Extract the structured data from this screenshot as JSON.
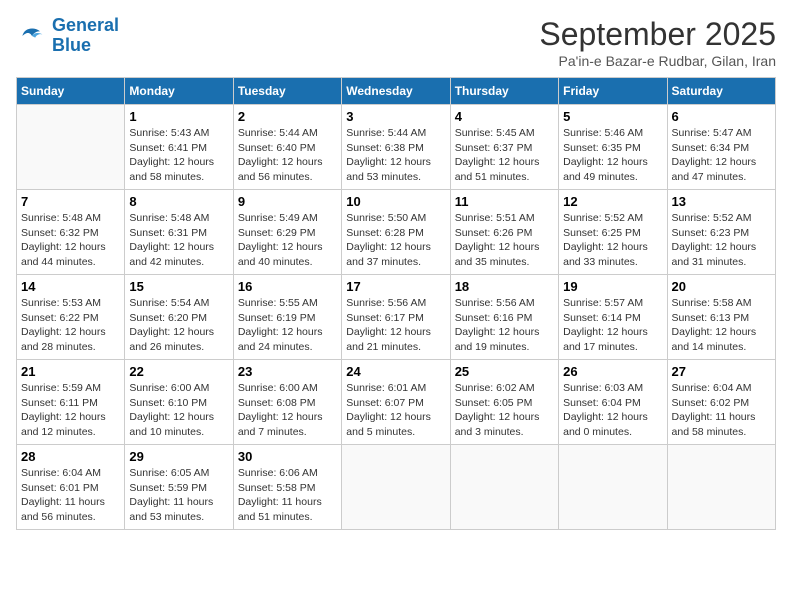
{
  "app": {
    "logo_line1": "General",
    "logo_line2": "Blue"
  },
  "header": {
    "title": "September 2025",
    "subtitle": "Pa'in-e Bazar-e Rudbar, Gilan, Iran"
  },
  "weekdays": [
    "Sunday",
    "Monday",
    "Tuesday",
    "Wednesday",
    "Thursday",
    "Friday",
    "Saturday"
  ],
  "weeks": [
    [
      {
        "day": "",
        "info": ""
      },
      {
        "day": "1",
        "info": "Sunrise: 5:43 AM\nSunset: 6:41 PM\nDaylight: 12 hours\nand 58 minutes."
      },
      {
        "day": "2",
        "info": "Sunrise: 5:44 AM\nSunset: 6:40 PM\nDaylight: 12 hours\nand 56 minutes."
      },
      {
        "day": "3",
        "info": "Sunrise: 5:44 AM\nSunset: 6:38 PM\nDaylight: 12 hours\nand 53 minutes."
      },
      {
        "day": "4",
        "info": "Sunrise: 5:45 AM\nSunset: 6:37 PM\nDaylight: 12 hours\nand 51 minutes."
      },
      {
        "day": "5",
        "info": "Sunrise: 5:46 AM\nSunset: 6:35 PM\nDaylight: 12 hours\nand 49 minutes."
      },
      {
        "day": "6",
        "info": "Sunrise: 5:47 AM\nSunset: 6:34 PM\nDaylight: 12 hours\nand 47 minutes."
      }
    ],
    [
      {
        "day": "7",
        "info": "Sunrise: 5:48 AM\nSunset: 6:32 PM\nDaylight: 12 hours\nand 44 minutes."
      },
      {
        "day": "8",
        "info": "Sunrise: 5:48 AM\nSunset: 6:31 PM\nDaylight: 12 hours\nand 42 minutes."
      },
      {
        "day": "9",
        "info": "Sunrise: 5:49 AM\nSunset: 6:29 PM\nDaylight: 12 hours\nand 40 minutes."
      },
      {
        "day": "10",
        "info": "Sunrise: 5:50 AM\nSunset: 6:28 PM\nDaylight: 12 hours\nand 37 minutes."
      },
      {
        "day": "11",
        "info": "Sunrise: 5:51 AM\nSunset: 6:26 PM\nDaylight: 12 hours\nand 35 minutes."
      },
      {
        "day": "12",
        "info": "Sunrise: 5:52 AM\nSunset: 6:25 PM\nDaylight: 12 hours\nand 33 minutes."
      },
      {
        "day": "13",
        "info": "Sunrise: 5:52 AM\nSunset: 6:23 PM\nDaylight: 12 hours\nand 31 minutes."
      }
    ],
    [
      {
        "day": "14",
        "info": "Sunrise: 5:53 AM\nSunset: 6:22 PM\nDaylight: 12 hours\nand 28 minutes."
      },
      {
        "day": "15",
        "info": "Sunrise: 5:54 AM\nSunset: 6:20 PM\nDaylight: 12 hours\nand 26 minutes."
      },
      {
        "day": "16",
        "info": "Sunrise: 5:55 AM\nSunset: 6:19 PM\nDaylight: 12 hours\nand 24 minutes."
      },
      {
        "day": "17",
        "info": "Sunrise: 5:56 AM\nSunset: 6:17 PM\nDaylight: 12 hours\nand 21 minutes."
      },
      {
        "day": "18",
        "info": "Sunrise: 5:56 AM\nSunset: 6:16 PM\nDaylight: 12 hours\nand 19 minutes."
      },
      {
        "day": "19",
        "info": "Sunrise: 5:57 AM\nSunset: 6:14 PM\nDaylight: 12 hours\nand 17 minutes."
      },
      {
        "day": "20",
        "info": "Sunrise: 5:58 AM\nSunset: 6:13 PM\nDaylight: 12 hours\nand 14 minutes."
      }
    ],
    [
      {
        "day": "21",
        "info": "Sunrise: 5:59 AM\nSunset: 6:11 PM\nDaylight: 12 hours\nand 12 minutes."
      },
      {
        "day": "22",
        "info": "Sunrise: 6:00 AM\nSunset: 6:10 PM\nDaylight: 12 hours\nand 10 minutes."
      },
      {
        "day": "23",
        "info": "Sunrise: 6:00 AM\nSunset: 6:08 PM\nDaylight: 12 hours\nand 7 minutes."
      },
      {
        "day": "24",
        "info": "Sunrise: 6:01 AM\nSunset: 6:07 PM\nDaylight: 12 hours\nand 5 minutes."
      },
      {
        "day": "25",
        "info": "Sunrise: 6:02 AM\nSunset: 6:05 PM\nDaylight: 12 hours\nand 3 minutes."
      },
      {
        "day": "26",
        "info": "Sunrise: 6:03 AM\nSunset: 6:04 PM\nDaylight: 12 hours\nand 0 minutes."
      },
      {
        "day": "27",
        "info": "Sunrise: 6:04 AM\nSunset: 6:02 PM\nDaylight: 11 hours\nand 58 minutes."
      }
    ],
    [
      {
        "day": "28",
        "info": "Sunrise: 6:04 AM\nSunset: 6:01 PM\nDaylight: 11 hours\nand 56 minutes."
      },
      {
        "day": "29",
        "info": "Sunrise: 6:05 AM\nSunset: 5:59 PM\nDaylight: 11 hours\nand 53 minutes."
      },
      {
        "day": "30",
        "info": "Sunrise: 6:06 AM\nSunset: 5:58 PM\nDaylight: 11 hours\nand 51 minutes."
      },
      {
        "day": "",
        "info": ""
      },
      {
        "day": "",
        "info": ""
      },
      {
        "day": "",
        "info": ""
      },
      {
        "day": "",
        "info": ""
      }
    ]
  ]
}
